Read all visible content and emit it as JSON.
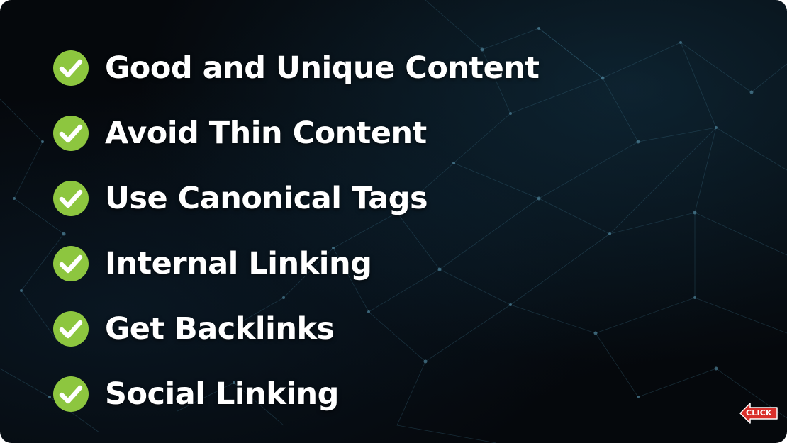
{
  "checklist": {
    "items": [
      {
        "label": "Good and Unique Content",
        "icon": "check-circle-icon"
      },
      {
        "label": "Avoid Thin Content",
        "icon": "check-circle-icon"
      },
      {
        "label": "Use Canonical Tags",
        "icon": "check-circle-icon"
      },
      {
        "label": "Internal Linking",
        "icon": "check-circle-icon"
      },
      {
        "label": "Get Backlinks",
        "icon": "check-circle-icon"
      },
      {
        "label": "Social Linking",
        "icon": "check-circle-icon"
      }
    ]
  },
  "click_badge": {
    "label": "CLICK",
    "icon": "left-arrow-icon"
  },
  "colors": {
    "check_green": "#8dc63f",
    "text": "#ffffff",
    "background": "#05080c",
    "badge_red": "#d9302b",
    "network_line": "#3d6f86"
  }
}
